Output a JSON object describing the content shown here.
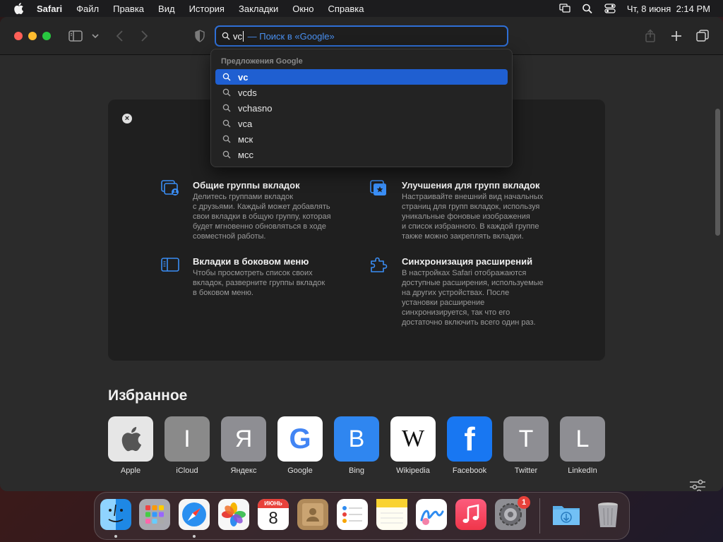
{
  "menubar": {
    "app_name": "Safari",
    "items": [
      "Файл",
      "Правка",
      "Вид",
      "История",
      "Закладки",
      "Окно",
      "Справка"
    ],
    "clock": "Чт, 8 июня  2:14 PM"
  },
  "toolbar": {
    "address_typed": "vc",
    "address_hint": " — Поиск в «Google»"
  },
  "suggestions": {
    "header": "Предложения Google",
    "items": [
      "vc",
      "vcds",
      "vchasno",
      "vca",
      "мск",
      "мсс"
    ],
    "selected_index": 0
  },
  "whats_new": {
    "features": [
      {
        "title": "Общие группы вкладок",
        "desc": "Делитесь группами вкладок\nс друзьями. Каждый может добавлять\nсвои вкладки в общую группу, которая\nбудет мгновенно обновляться в ходе\nсовместной работы.",
        "icon": "shared-tab-groups-icon"
      },
      {
        "title": "Улучшения для групп вкладок",
        "desc": "Настраивайте внешний вид начальных\nстраниц для групп вкладок, используя\nуникальные фоновые изображения\nи список избранного. В каждой группе\nтакже можно закреплять вкладки.",
        "icon": "tab-group-improvements-icon"
      },
      {
        "title": "Вкладки в боковом меню",
        "desc": "Чтобы просмотреть список своих\nвкладок, разверните группы вкладок\nв боковом меню.",
        "icon": "sidebar-tabs-icon"
      },
      {
        "title": "Синхронизация расширений",
        "desc": "В настройках Safari отображаются\nдоступные расширения, используемые\nна других устройствах. После\nустановки расширение\nсинхронизируется, так что его\nдостаточно включить всего один раз.",
        "icon": "extension-sync-icon"
      }
    ]
  },
  "favorites": {
    "title": "Избранное",
    "items": [
      {
        "label": "Apple",
        "glyph": "",
        "bg": "#e6e6e6",
        "fg": "#555555"
      },
      {
        "label": "iCloud",
        "glyph": "I",
        "bg": "#8a8a8a",
        "fg": "#ffffff"
      },
      {
        "label": "Яндекс",
        "glyph": "Я",
        "bg": "#8e8e93",
        "fg": "#ffffff"
      },
      {
        "label": "Google",
        "glyph": "G",
        "bg": "#ffffff",
        "fg": "#4285f4"
      },
      {
        "label": "Bing",
        "glyph": "B",
        "bg": "#2f86f0",
        "fg": "#ffffff"
      },
      {
        "label": "Wikipedia",
        "glyph": "W",
        "bg": "#ffffff",
        "fg": "#111111"
      },
      {
        "label": "Facebook",
        "glyph": "f",
        "bg": "#1877f2",
        "fg": "#ffffff"
      },
      {
        "label": "Twitter",
        "glyph": "T",
        "bg": "#8e8e93",
        "fg": "#ffffff"
      },
      {
        "label": "LinkedIn",
        "glyph": "L",
        "bg": "#8e8e93",
        "fg": "#ffffff"
      }
    ]
  },
  "dock": {
    "calendar_month": "ИЮНЬ",
    "calendar_day": "8",
    "settings_badge": "1",
    "apps": [
      "finder",
      "launchpad",
      "safari",
      "photos",
      "calendar",
      "contacts",
      "reminders",
      "notes",
      "freeform",
      "music",
      "system-settings"
    ]
  },
  "colors": {
    "accent": "#2f6fd6",
    "selection": "#1f5fd1",
    "feature_icon": "#3a8ef6"
  }
}
